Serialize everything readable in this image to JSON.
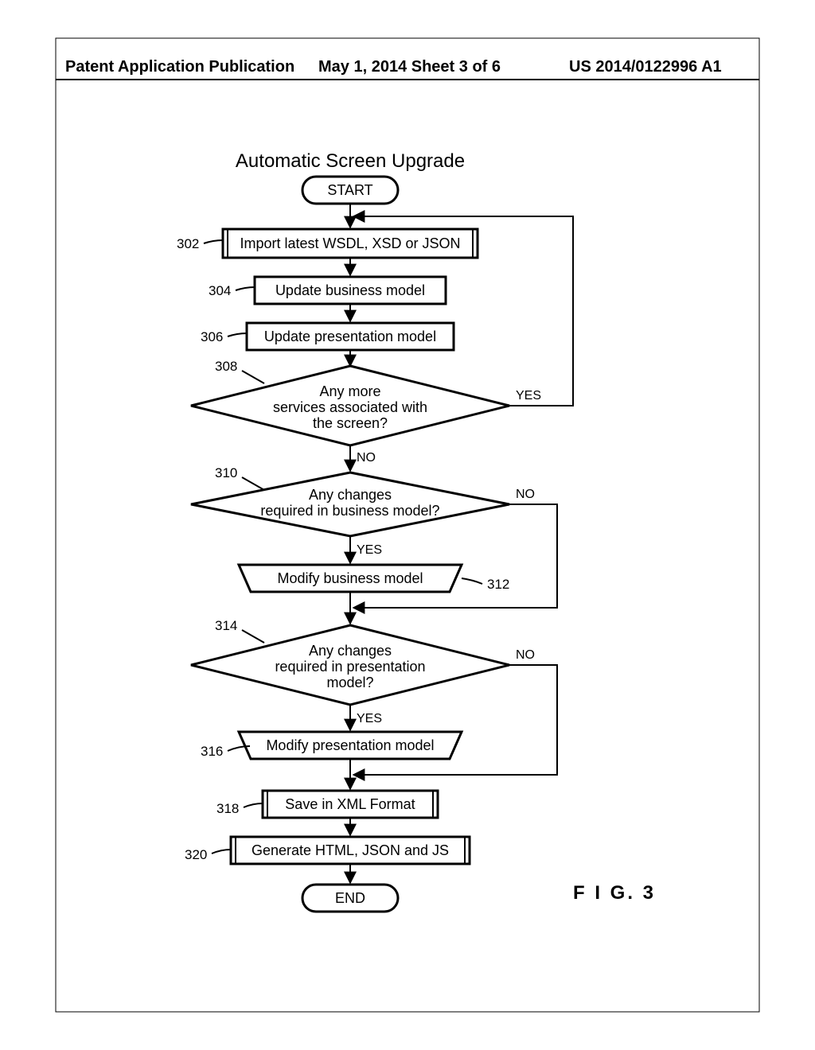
{
  "header": {
    "left": "Patent Application Publication",
    "mid": "May 1, 2014  Sheet 3 of 6",
    "right": "US 2014/0122996 A1"
  },
  "diagram": {
    "title": "Automatic Screen Upgrade",
    "figure_label": "F I G. 3",
    "start": "START",
    "end": "END",
    "steps": {
      "s302": "Import latest WSDL, XSD or JSON",
      "s304": "Update business model",
      "s306": "Update presentation model",
      "s312": "Modify business model",
      "s316": "Modify presentation model",
      "s318": "Save in XML Format",
      "s320": "Generate HTML, JSON and JS"
    },
    "decisions": {
      "d308_l1": "Any more",
      "d308_l2": "services associated with",
      "d308_l3": "the screen?",
      "d310_l1": "Any changes",
      "d310_l2": "required in business model?",
      "d314_l1": "Any changes",
      "d314_l2": "required in presentation",
      "d314_l3": "model?"
    },
    "labels": {
      "yes": "YES",
      "no": "NO",
      "r302": "302",
      "r304": "304",
      "r306": "306",
      "r308": "308",
      "r310": "310",
      "r312": "312",
      "r314": "314",
      "r316": "316",
      "r318": "318",
      "r320": "320"
    }
  }
}
